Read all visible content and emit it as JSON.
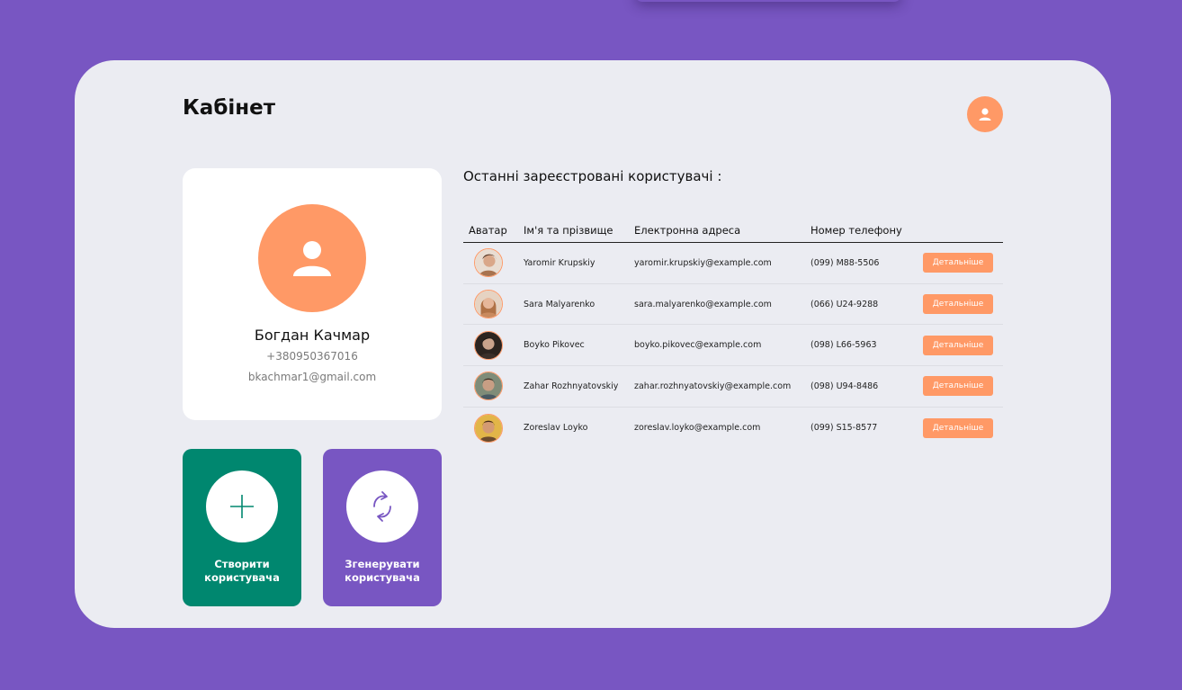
{
  "page": {
    "title": "Кабінет"
  },
  "colors": {
    "background": "#7856c2",
    "accent": "#ff9966",
    "create": "#00876f",
    "generate": "#7856c2",
    "panel": "#ebecf2"
  },
  "profile": {
    "name": "Богдан Качмар",
    "phone": "+380950367016",
    "email": "bkachmar1@gmail.com"
  },
  "actions": {
    "create_label_1": "Створити",
    "create_label_2": "користувача",
    "generate_label_1": "Згенерувати",
    "generate_label_2": "користувача"
  },
  "users_section": {
    "title": "Останні зареєстровані користувачі :",
    "columns": [
      "Аватар",
      "Ім'я та прізвище",
      "Електронна адреса",
      "Номер телефону"
    ],
    "details_label": "Детальніше",
    "rows": [
      {
        "name": "Yaromir Krupskiy",
        "email": "yaromir.krupskiy@example.com",
        "phone": "(099) M88-5506"
      },
      {
        "name": "Sara Malyarenko",
        "email": "sara.malyarenko@example.com",
        "phone": "(066) U24-9288"
      },
      {
        "name": "Boyko Pikovec",
        "email": "boyko.pikovec@example.com",
        "phone": "(098) L66-5963"
      },
      {
        "name": "Zahar Rozhnyatovskiy",
        "email": "zahar.rozhnyatovskiy@example.com",
        "phone": "(098) U94-8486"
      },
      {
        "name": "Zoreslav Loyko",
        "email": "zoreslav.loyko@example.com",
        "phone": "(099) S15-8577"
      }
    ]
  },
  "icons": {
    "top_avatar": "user-icon",
    "profile_avatar": "user-icon",
    "create": "plus-icon",
    "generate": "refresh-icon"
  }
}
